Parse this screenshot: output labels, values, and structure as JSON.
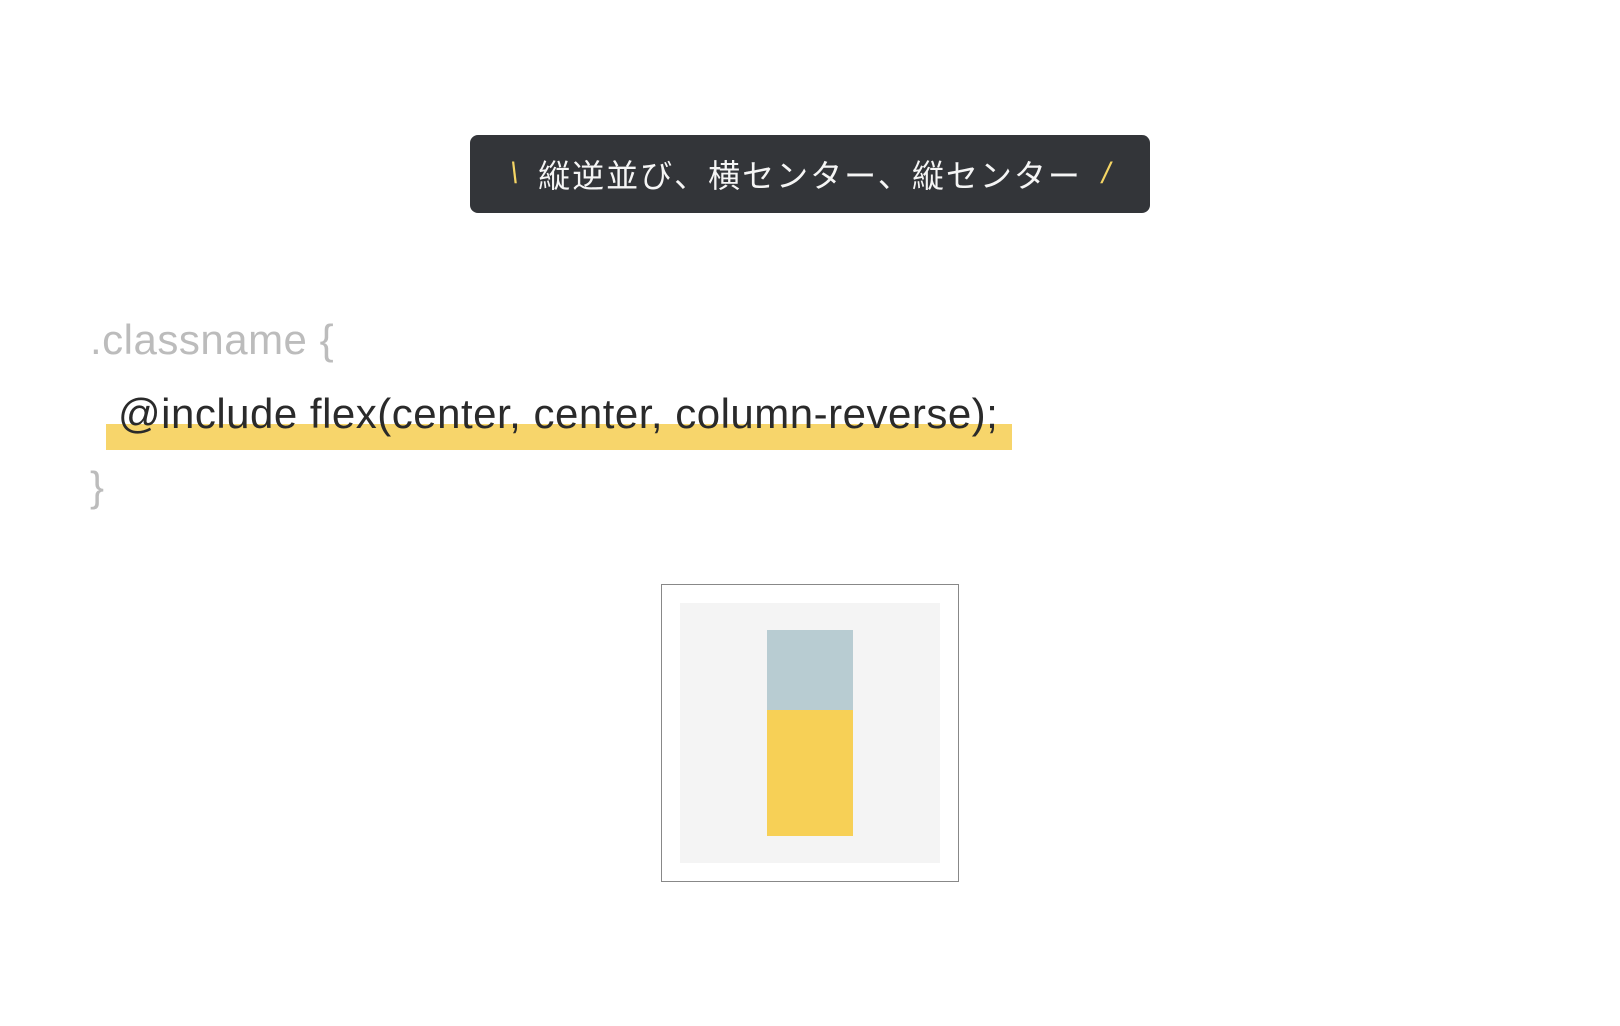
{
  "title": {
    "text": "縦逆並び、横センター、縦センター",
    "slash_left": "\\",
    "slash_right": "/"
  },
  "code": {
    "line1": ".classname {",
    "line2": "@include flex(center, center, column-reverse);",
    "line3": "}"
  },
  "colors": {
    "badge_bg": "#333539",
    "badge_text": "#f5f5f5",
    "accent_yellow": "#f5d564",
    "highlight": "#f7d56b",
    "muted": "#bcbcbc",
    "box_yellow": "#f7d056",
    "box_blue": "#b8ccd2",
    "demo_bg": "#f4f4f4"
  },
  "demo": {
    "flex_direction": "column-reverse",
    "justify_content": "center",
    "align_items": "center"
  }
}
